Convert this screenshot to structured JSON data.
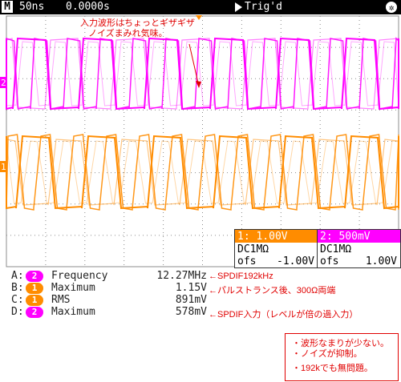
{
  "header": {
    "mode_letter": "M",
    "timebase": "50ns",
    "delay": "0.0000s",
    "trigger_status": "Trig'd"
  },
  "channels": [
    {
      "marker": "2",
      "scale": "2: 500mV",
      "coupling": "DC1MΩ",
      "offset_label": "ofs",
      "offset_value": "1.00V",
      "color": "#ff00ff"
    },
    {
      "marker": "1",
      "scale": "1: 1.00V",
      "coupling": "DC1MΩ",
      "offset_label": "ofs",
      "offset_value": "-1.00V",
      "color": "#ff8c00"
    }
  ],
  "measurements": [
    {
      "letter": "A:",
      "channel": "2",
      "name": "Frequency",
      "value": "12.27MHz",
      "note": "←SPDIF192kHz"
    },
    {
      "letter": "B:",
      "channel": "1",
      "name": "Maximum",
      "value": "1.15V",
      "note": "←パルストランス後、300Ω両端"
    },
    {
      "letter": "C:",
      "channel": "1",
      "name": "RMS",
      "value": "891mV",
      "note": ""
    },
    {
      "letter": "D:",
      "channel": "2",
      "name": "Maximum",
      "value": "578mV",
      "note": "←SPDIF入力（レベルが倍の過入力）"
    }
  ],
  "annotations": {
    "top_line1": "入力波形はちょっとギザギザ",
    "top_line2": "ノイズまみれ気味。"
  },
  "notes": [
    "・波形なまりが少ない。",
    "・ノイズが抑制。",
    "・192kでも無問題。"
  ],
  "colors": {
    "ch1": "#ff8c00",
    "ch2": "#ff00ff",
    "grid": "#8c8c8c",
    "annotation": "#e00000"
  }
}
